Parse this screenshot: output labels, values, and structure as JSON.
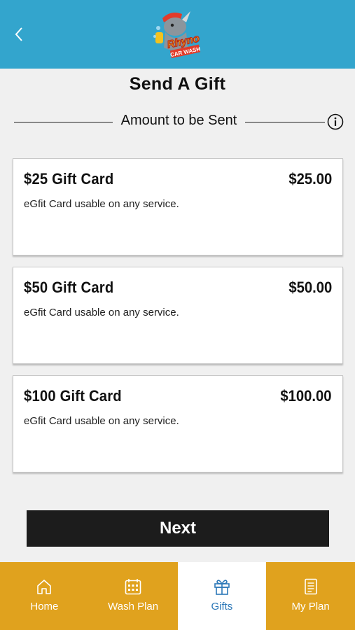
{
  "header": {
    "logo_line1": "Rhyno",
    "logo_line2": "CAR WASH"
  },
  "page": {
    "title": "Send A Gift",
    "section_label": "Amount to be Sent"
  },
  "cards": [
    {
      "name": "$25 Gift Card",
      "price": "$25.00",
      "description": "eGfit Card usable on any service."
    },
    {
      "name": "$50 Gift Card",
      "price": "$50.00",
      "description": "eGfit Card usable on any service."
    },
    {
      "name": "$100 Gift Card",
      "price": "$100.00",
      "description": "eGfit Card usable on any service."
    }
  ],
  "next_label": "Next",
  "tabs": [
    {
      "label": "Home",
      "icon": "home-icon"
    },
    {
      "label": "Wash Plan",
      "icon": "calendar-icon"
    },
    {
      "label": "Gifts",
      "icon": "gift-icon",
      "active": true
    },
    {
      "label": "My Plan",
      "icon": "document-icon"
    }
  ],
  "colors": {
    "header": "#33a5cd",
    "tabbar": "#e0a21e",
    "active_tab_text": "#2c78b8",
    "button": "#1c1c1c"
  }
}
